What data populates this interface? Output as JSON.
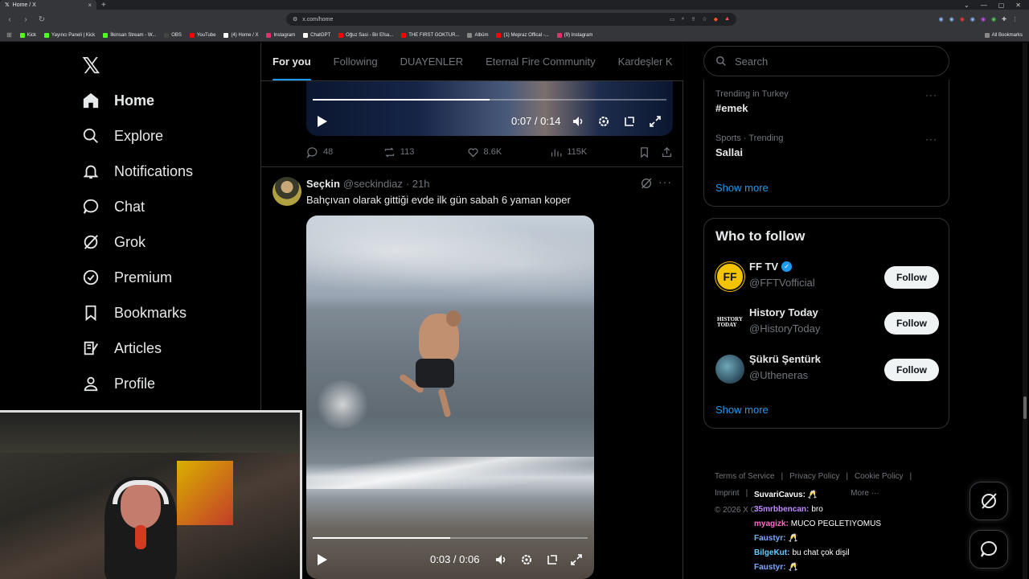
{
  "browser": {
    "tab_title": "Home / X",
    "url": "x.com/home",
    "bookmarks": [
      {
        "label": "Kick",
        "color": "#53fc18"
      },
      {
        "label": "Yayıncı Paneli | Kick",
        "color": "#53fc18"
      },
      {
        "label": "İlkinsan Stream - W...",
        "color": "#53fc18"
      },
      {
        "label": "OBS",
        "color": "#444444"
      },
      {
        "label": "YouTube",
        "color": "#ff0000"
      },
      {
        "label": "(4) Home / X",
        "color": "#ffffff"
      },
      {
        "label": "Instagram",
        "color": "#e1306c"
      },
      {
        "label": "ChatGPT",
        "color": "#ffffff"
      },
      {
        "label": "Oğuz Sasi - Bir Efsa...",
        "color": "#ff0000"
      },
      {
        "label": "THE FIRST GOKTUR...",
        "color": "#ff0000"
      },
      {
        "label": "Albüm",
        "color": "#888888"
      },
      {
        "label": "(1) Mepraz Offical -...",
        "color": "#ff0000"
      },
      {
        "label": "(9) Instagram",
        "color": "#e1306c"
      }
    ],
    "all_bookmarks": "All Bookmarks"
  },
  "nav": {
    "items": [
      {
        "label": "Home",
        "icon": "home-icon"
      },
      {
        "label": "Explore",
        "icon": "search-icon"
      },
      {
        "label": "Notifications",
        "icon": "bell-icon"
      },
      {
        "label": "Chat",
        "icon": "chat-icon"
      },
      {
        "label": "Grok",
        "icon": "grok-icon"
      },
      {
        "label": "Premium",
        "icon": "premium-icon"
      },
      {
        "label": "Bookmarks",
        "icon": "bookmark-icon"
      },
      {
        "label": "Articles",
        "icon": "articles-icon"
      },
      {
        "label": "Profile",
        "icon": "profile-icon"
      }
    ]
  },
  "timeline_tabs": [
    "For you",
    "Following",
    "DUAYENLER",
    "Eternal Fire Community",
    "Kardeşler K"
  ],
  "prev_post": {
    "video_time": "0:07 / 0:14",
    "progress": 0.5,
    "replies": "48",
    "reposts": "113",
    "likes": "8.6K",
    "views": "115K"
  },
  "post": {
    "name": "Seçkin",
    "handle": "@seckindiaz",
    "time": "· 21h",
    "text": "Bahçıvan olarak gittiği evde ilk gün sabah 6 yaman koper",
    "video_time": "0:03 / 0:06",
    "progress": 0.5
  },
  "right": {
    "search_placeholder": "Search",
    "trends": [
      {
        "meta": "Trending in Turkey",
        "name": "#emek"
      },
      {
        "meta": "Sports · Trending",
        "name": "Sallai"
      }
    ],
    "show_more": "Show more",
    "who_to_follow": "Who to follow",
    "accounts": [
      {
        "name": "FF TV",
        "handle": "@FFTVofficial",
        "verified": true,
        "follow": "Follow"
      },
      {
        "name": "History Today",
        "handle": "@HistoryToday",
        "verified": false,
        "follow": "Follow"
      },
      {
        "name": "Şükrü Şentürk",
        "handle": "@Utheneras",
        "verified": false,
        "follow": "Follow"
      }
    ],
    "footer": {
      "terms": "Terms of Service",
      "privacy": "Privacy Policy",
      "cookie": "Cookie Policy",
      "imprint": "Imprint",
      "more": "More ···",
      "copyright": "© 2026 X C"
    }
  },
  "stream_chat": [
    {
      "user": "SuvariCavus:",
      "msg": "🥂",
      "color": "#ffffff"
    },
    {
      "user": "35mrbbencan:",
      "msg": "bro",
      "color": "#c08cff"
    },
    {
      "user": "myagizk:",
      "msg": "MUCO PEGLETIYOMUS",
      "color": "#ff6ec7"
    },
    {
      "user": "Faustyr:",
      "msg": "🥂",
      "color": "#7fa8ff"
    },
    {
      "user": "BilgeKut:",
      "msg": "bu chat çok dişil",
      "color": "#66ccff"
    },
    {
      "user": "Faustyr:",
      "msg": "🥂",
      "color": "#7fa8ff"
    }
  ]
}
